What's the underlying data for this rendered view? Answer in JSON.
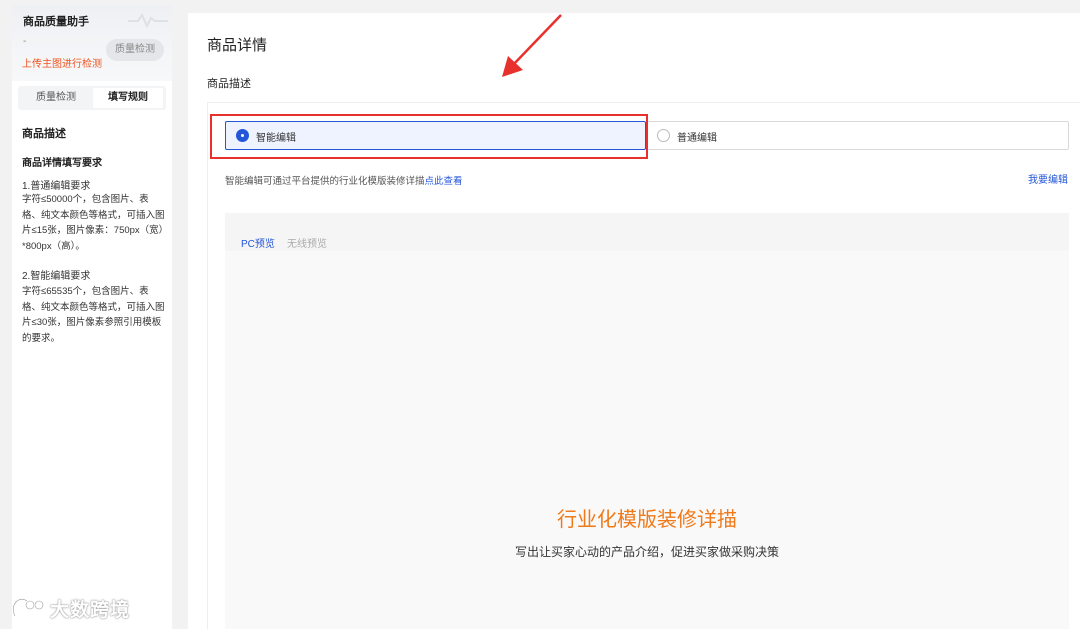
{
  "left_panel": {
    "app_title": "商品质量助手",
    "dash": "-",
    "quality_button": "质量检测",
    "upload_tip": "上传主图进行检测",
    "tabs": [
      {
        "label": "质量检测"
      },
      {
        "label": "填写规则"
      }
    ],
    "rules_title": "商品描述",
    "rules_subtitle": "商品详情填写要求",
    "rule1_title": "1.普通编辑要求",
    "rule1_text": "字符≤50000个，包含图片、表格、纯文本颜色等格式，可插入图片≤15张，图片像素：750px（宽）*800px（高）。",
    "rule2_title": "2.智能编辑要求",
    "rule2_text": "字符≤65535个，包含图片、表格、纯文本颜色等格式，可插入图片≤30张，图片像素参照引用模板的要求。"
  },
  "main": {
    "page_title": "商品详情",
    "section_title": "商品描述",
    "options": [
      {
        "label": "智能编辑",
        "selected": true
      },
      {
        "label": "普通编辑",
        "selected": false
      }
    ],
    "info_text": "智能编辑可通过平台提供的行业化模版装修详描",
    "info_link": "点此查看",
    "edit_link": "我要编辑",
    "preview_tabs": [
      {
        "label": "PC预览",
        "active": true
      },
      {
        "label": "无线预览",
        "active": false
      }
    ],
    "hero_title": "行业化模版装修详描",
    "hero_subtitle": "写出让买家心动的产品介绍，促进买家做采购决策"
  },
  "watermark": {
    "text": "大数跨境"
  },
  "colors": {
    "accent_blue": "#2456d8",
    "highlight_red": "#e8302c",
    "hero_orange": "#f07a1a",
    "tip_orange": "#f0531f"
  },
  "icons": [
    "pulse-icon",
    "radio-icon",
    "arrow-icon",
    "watermark-logo-icon"
  ]
}
